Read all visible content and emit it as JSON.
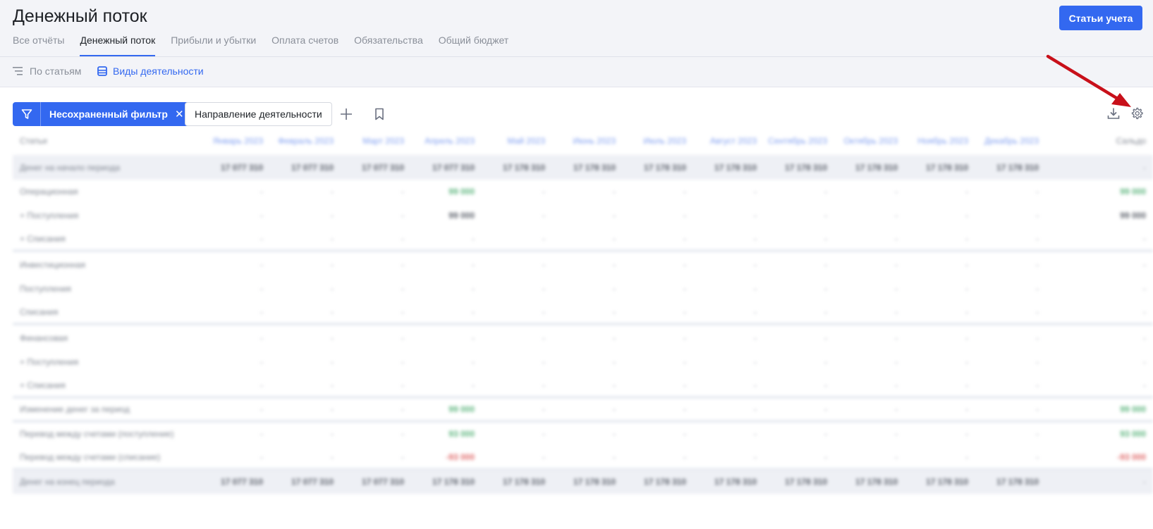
{
  "header": {
    "title": "Денежный поток",
    "primary_button": "Статьи учета",
    "tabs": [
      {
        "label": "Все отчёты",
        "active": false
      },
      {
        "label": "Денежный поток",
        "active": true
      },
      {
        "label": "Прибыли и убытки",
        "active": false
      },
      {
        "label": "Оплата счетов",
        "active": false
      },
      {
        "label": "Обязательства",
        "active": false
      },
      {
        "label": "Общий бюджет",
        "active": false
      }
    ]
  },
  "subbar": {
    "by_items": "По статьям",
    "by_activity": "Виды деятельности"
  },
  "toolbar": {
    "filter_label": "Несохраненный фильтр",
    "dimension_label": "Направление деятельности"
  },
  "colors": {
    "accent": "#3368f0",
    "annotation_arrow": "#c8101a",
    "positive": "#5bb47c",
    "negative": "#e06a6a"
  },
  "icons": [
    "filter-icon",
    "close-icon",
    "plus-icon",
    "bookmark-icon",
    "download-icon",
    "gear-icon",
    "list-icon",
    "table-icon"
  ],
  "table": {
    "header": {
      "label": "Статьи",
      "months": [
        "Январь 2023",
        "Февраль 2023",
        "Март 2023",
        "Апрель 2023",
        "Май 2023",
        "Июнь 2023",
        "Июль 2023",
        "Август 2023",
        "Сентябрь 2023",
        "Октябрь 2023",
        "Ноябрь 2023",
        "Декабрь 2023"
      ],
      "total": "Сальдо"
    },
    "rows": [
      {
        "label": "Денег на начало периода",
        "style": "hl",
        "cells": [
          "17 077 310",
          "17 077 310",
          "17 077 310",
          "17 077 310",
          "17 178 310",
          "17 178 310",
          "17 178 310",
          "17 178 310",
          "17 178 310",
          "17 178 310",
          "17 178 310",
          "17 178 310"
        ],
        "kind": "num",
        "total": "-",
        "total_kind": ""
      },
      {
        "label": "Операционная",
        "style": "",
        "cells": [
          "-",
          "-",
          "-",
          "99 000",
          "-",
          "-",
          "-",
          "-",
          "-",
          "-",
          "-",
          "-"
        ],
        "kind": "pos4",
        "total": "99 000",
        "total_kind": "pos"
      },
      {
        "label": "+ Поступления",
        "style": "",
        "cells": [
          "-",
          "-",
          "-",
          "99 000",
          "-",
          "-",
          "-",
          "-",
          "-",
          "-",
          "-",
          "-"
        ],
        "kind": "num4",
        "total": "99 000",
        "total_kind": "num"
      },
      {
        "label": "+ Списания",
        "style": "sep",
        "cells": [
          "-",
          "-",
          "-",
          "-",
          "-",
          "-",
          "-",
          "-",
          "-",
          "-",
          "-",
          "-"
        ],
        "kind": "",
        "total": "-",
        "total_kind": ""
      },
      {
        "label": "Инвестиционная",
        "style": "",
        "cells": [
          "-",
          "-",
          "-",
          "-",
          "-",
          "-",
          "-",
          "-",
          "-",
          "-",
          "-",
          "-"
        ],
        "kind": "",
        "total": "-",
        "total_kind": ""
      },
      {
        "label": "Поступления",
        "style": "",
        "cells": [
          "-",
          "-",
          "-",
          "-",
          "-",
          "-",
          "-",
          "-",
          "-",
          "-",
          "-",
          "-"
        ],
        "kind": "",
        "total": "-",
        "total_kind": ""
      },
      {
        "label": "Списания",
        "style": "sep",
        "cells": [
          "-",
          "-",
          "-",
          "-",
          "-",
          "-",
          "-",
          "-",
          "-",
          "-",
          "-",
          "-"
        ],
        "kind": "",
        "total": "-",
        "total_kind": ""
      },
      {
        "label": "Финансовая",
        "style": "",
        "cells": [
          "-",
          "-",
          "-",
          "-",
          "-",
          "-",
          "-",
          "-",
          "-",
          "-",
          "-",
          "-"
        ],
        "kind": "",
        "total": "-",
        "total_kind": ""
      },
      {
        "label": "+ Поступления",
        "style": "",
        "cells": [
          "-",
          "-",
          "-",
          "-",
          "-",
          "-",
          "-",
          "-",
          "-",
          "-",
          "-",
          "-"
        ],
        "kind": "",
        "total": "-",
        "total_kind": ""
      },
      {
        "label": "+ Списания",
        "style": "sep",
        "cells": [
          "-",
          "-",
          "-",
          "-",
          "-",
          "-",
          "-",
          "-",
          "-",
          "-",
          "-",
          "-"
        ],
        "kind": "",
        "total": "-",
        "total_kind": ""
      },
      {
        "label": "Изменение денег за период",
        "style": "sep",
        "cells": [
          "-",
          "-",
          "-",
          "99 000",
          "-",
          "-",
          "-",
          "-",
          "-",
          "-",
          "-",
          "-"
        ],
        "kind": "pos4",
        "total": "99 000",
        "total_kind": "pos"
      },
      {
        "label": "Перевод между счетами (поступление)",
        "style": "",
        "cells": [
          "-",
          "-",
          "-",
          "93 000",
          "-",
          "-",
          "-",
          "-",
          "-",
          "-",
          "-",
          "-"
        ],
        "kind": "pos4",
        "total": "93 000",
        "total_kind": "pos"
      },
      {
        "label": "Перевод между счетами (списание)",
        "style": "sep",
        "cells": [
          "-",
          "-",
          "-",
          "-93 000",
          "-",
          "-",
          "-",
          "-",
          "-",
          "-",
          "-",
          "-"
        ],
        "kind": "neg4",
        "total": "-93 000",
        "total_kind": "neg"
      },
      {
        "label": "Денег на конец периода",
        "style": "hl",
        "cells": [
          "17 077 310",
          "17 077 310",
          "17 077 310",
          "17 178 310",
          "17 178 310",
          "17 178 310",
          "17 178 310",
          "17 178 310",
          "17 178 310",
          "17 178 310",
          "17 178 310",
          "17 178 310"
        ],
        "kind": "num",
        "total": "-",
        "total_kind": ""
      }
    ]
  }
}
